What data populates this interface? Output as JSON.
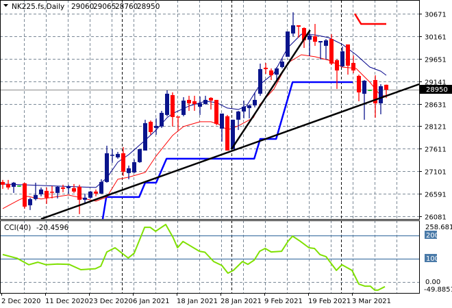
{
  "header": {
    "symbol": "NK225.fs,Daily",
    "open": "29060",
    "high": "29065",
    "low": "28760",
    "close": "28950"
  },
  "colors": {
    "bull": "#0a148c",
    "bear": "#ff0000",
    "ma_fast": "#00008b",
    "ma_slow": "#ff0000",
    "step_blue": "#0000ff",
    "step_red": "#ff0000",
    "trend": "#000000",
    "cci": "#7fe000",
    "grid": "#7a8896",
    "level": "#4a7aa8"
  },
  "chart_data": [
    {
      "type": "candlestick",
      "title": "NK225.fs,Daily",
      "ylim": [
        26081,
        30671
      ],
      "y_ticks": [
        "30671",
        "30161",
        "29651",
        "29141",
        "28631",
        "28121",
        "27611",
        "27101",
        "26591",
        "26081"
      ],
      "y_tick_values": [
        30671,
        30161,
        29651,
        29141,
        28631,
        28121,
        27611,
        27101,
        26591,
        26081
      ],
      "current_price": "28950",
      "x_labels": [
        {
          "bar": 0,
          "label": "2 Dec 2020"
        },
        {
          "bar": 8,
          "label": "11 Dec 2020"
        },
        {
          "bar": 16,
          "label": "23 Dec 2020"
        },
        {
          "bar": 24,
          "label": "6 Jan 2021"
        },
        {
          "bar": 32,
          "label": "18 Jan 2021"
        },
        {
          "bar": 40,
          "label": "28 Jan 2021"
        },
        {
          "bar": 48,
          "label": "9 Feb 2021"
        },
        {
          "bar": 56,
          "label": "19 Feb 2021"
        },
        {
          "bar": 64,
          "label": "3 Mar 2021"
        }
      ],
      "month_separators": [
        22,
        42,
        62
      ],
      "ohlc": [
        [
          26858,
          26905,
          26703,
          26796
        ],
        [
          26812,
          26905,
          26687,
          26734
        ],
        [
          26749,
          26858,
          26610,
          26842
        ],
        [
          26765,
          26780,
          26750,
          26765
        ],
        [
          26827,
          26842,
          26254,
          26300
        ],
        [
          26331,
          26502,
          26223,
          26471
        ],
        [
          26471,
          26842,
          26440,
          26564
        ],
        [
          26579,
          26734,
          26533,
          26688
        ],
        [
          26657,
          26734,
          26362,
          26502
        ],
        [
          26626,
          26765,
          26486,
          26610
        ],
        [
          26610,
          26765,
          26486,
          26749
        ],
        [
          26734,
          26796,
          26626,
          26703
        ],
        [
          26718,
          26796,
          26595,
          26749
        ],
        [
          26718,
          26812,
          26610,
          26641
        ],
        [
          26749,
          26796,
          26130,
          26455
        ],
        [
          26455,
          26595,
          26362,
          26502
        ],
        [
          26502,
          26657,
          26486,
          26641
        ],
        [
          26641,
          26688,
          26533,
          26595
        ],
        [
          26595,
          26920,
          26595,
          26858
        ],
        [
          26858,
          27680,
          26842,
          27509
        ],
        [
          27447,
          27602,
          27292,
          27463
        ],
        [
          27416,
          27540,
          27385,
          27494
        ],
        [
          27509,
          27648,
          26997,
          27090
        ],
        [
          27060,
          27230,
          26920,
          27168
        ],
        [
          27075,
          27370,
          27060,
          27308
        ],
        [
          27308,
          27602,
          27292,
          27602
        ],
        [
          27571,
          28268,
          27571,
          28191
        ],
        [
          28222,
          28253,
          27928,
          27990
        ],
        [
          28083,
          28300,
          27928,
          28129
        ],
        [
          28114,
          28470,
          28083,
          28424
        ],
        [
          28377,
          28935,
          28346,
          28858
        ],
        [
          28826,
          28888,
          28114,
          28330
        ],
        [
          28330,
          28330,
          28036,
          28315
        ],
        [
          28377,
          28780,
          28346,
          28702
        ],
        [
          28718,
          28811,
          28470,
          28640
        ],
        [
          28687,
          28811,
          28470,
          28625
        ],
        [
          28563,
          28795,
          28377,
          28640
        ],
        [
          28625,
          28811,
          28610,
          28718
        ],
        [
          28764,
          28780,
          28501,
          28702
        ],
        [
          28718,
          28718,
          28145,
          28176
        ],
        [
          28067,
          28408,
          27772,
          28408
        ],
        [
          28346,
          28377,
          27571,
          27571
        ],
        [
          27602,
          28269,
          27602,
          28269
        ],
        [
          28269,
          28470,
          28036,
          28455
        ],
        [
          28455,
          28703,
          28300,
          28563
        ],
        [
          28532,
          28610,
          28300,
          28594
        ],
        [
          28594,
          28888,
          28548,
          28718
        ],
        [
          28858,
          29540,
          28811,
          29416
        ],
        [
          29446,
          29555,
          29307,
          29416
        ],
        [
          29385,
          29431,
          29168,
          29276
        ],
        [
          29291,
          29462,
          29121,
          29431
        ],
        [
          29462,
          29664,
          29431,
          29586
        ],
        [
          29695,
          30268,
          29695,
          30268
        ],
        [
          30222,
          30702,
          30160,
          30408
        ],
        [
          30408,
          30408,
          30129,
          30377
        ],
        [
          30346,
          30361,
          29896,
          30067
        ],
        [
          30082,
          30253,
          29710,
          30175
        ],
        [
          30160,
          30439,
          29943,
          30036
        ],
        [
          30020,
          30051,
          29633,
          30051
        ],
        [
          29943,
          30098,
          29633,
          30067
        ],
        [
          30098,
          30206,
          29509,
          29540
        ],
        [
          29617,
          29633,
          28966,
          29385
        ],
        [
          29478,
          29927,
          29462,
          29819
        ],
        [
          29974,
          29974,
          29291,
          29493
        ],
        [
          29555,
          29726,
          29323,
          29385
        ],
        [
          29261,
          29291,
          28687,
          28888
        ],
        [
          28857,
          29168,
          28268,
          29152
        ],
        [
          28935,
          28950,
          28920,
          28935
        ],
        [
          29168,
          29276,
          28315,
          28640
        ],
        [
          28640,
          29075,
          28392,
          29028
        ],
        [
          29060,
          29065,
          28760,
          28950
        ]
      ],
      "ma_fast": [
        [
          0,
          26812
        ],
        [
          17,
          26734
        ],
        [
          19,
          26951
        ],
        [
          21,
          27308
        ],
        [
          23,
          27478
        ],
        [
          26,
          27804
        ],
        [
          28,
          28036
        ],
        [
          30,
          28315
        ],
        [
          31,
          28408
        ],
        [
          34,
          28579
        ],
        [
          37,
          28687
        ],
        [
          39,
          28656
        ],
        [
          41,
          28532
        ],
        [
          43,
          28501
        ],
        [
          44.5,
          28579
        ],
        [
          47,
          29074
        ],
        [
          49.5,
          29323
        ],
        [
          52,
          29896
        ],
        [
          54.5,
          30206
        ],
        [
          57,
          30191
        ],
        [
          59.5,
          30129
        ],
        [
          62,
          29974
        ],
        [
          64.5,
          29741
        ],
        [
          67,
          29462
        ],
        [
          69,
          29369
        ],
        [
          70,
          29276
        ]
      ],
      "ma_slow": [
        [
          0,
          26254
        ],
        [
          3,
          26455
        ],
        [
          4.5,
          26533
        ],
        [
          7,
          26471
        ],
        [
          12,
          26564
        ],
        [
          17,
          26424
        ],
        [
          19,
          26517
        ],
        [
          21,
          26920
        ],
        [
          23,
          26966
        ],
        [
          26,
          27075
        ],
        [
          28,
          27447
        ],
        [
          31,
          27912
        ],
        [
          33,
          28114
        ],
        [
          36,
          28222
        ],
        [
          38,
          28222
        ],
        [
          39.5,
          28160
        ],
        [
          41,
          28036
        ],
        [
          43,
          28129
        ],
        [
          45.75,
          28315
        ],
        [
          47,
          28625
        ],
        [
          49.5,
          28966
        ],
        [
          52,
          29555
        ],
        [
          54.5,
          29741
        ],
        [
          57,
          29695
        ],
        [
          59.5,
          29617
        ],
        [
          62,
          29462
        ],
        [
          64.5,
          29431
        ],
        [
          67,
          29121
        ],
        [
          69,
          28811
        ],
        [
          70,
          28811
        ]
      ],
      "step_blue": [
        [
          18.25,
          26021
        ],
        [
          18.9,
          26517
        ],
        [
          24.9,
          26517
        ],
        [
          26,
          26842
        ],
        [
          28,
          26842
        ],
        [
          29.9,
          27385
        ],
        [
          45.9,
          27385
        ],
        [
          47,
          27834
        ],
        [
          49.9,
          27834
        ],
        [
          52.9,
          29121
        ],
        [
          63.9,
          29121
        ]
      ],
      "step_red": [
        [
          64.25,
          30671
        ],
        [
          65.4,
          30439
        ],
        [
          70,
          30439
        ]
      ],
      "trendlines": [
        [
          [
            7,
            26021
          ],
          [
            76,
            29074
          ]
        ],
        [
          [
            41.75,
            27602
          ],
          [
            56.1,
            30299
          ]
        ]
      ]
    },
    {
      "type": "line",
      "title": "CCI(40)",
      "value_label": "-20.4596",
      "ylim": [
        -49.8851,
        258.6815
      ],
      "y_labels": {
        "max": "258.6815",
        "l200": "200",
        "l100": "100",
        "zero": "0.00",
        "min": "-49.8851"
      },
      "levels": [
        200,
        100,
        0
      ],
      "points": [
        [
          0,
          118
        ],
        [
          2.6,
          102
        ],
        [
          4.75,
          74
        ],
        [
          6.4,
          85
        ],
        [
          7.9,
          74
        ],
        [
          10,
          77
        ],
        [
          12.1,
          76
        ],
        [
          14.25,
          53
        ],
        [
          16.9,
          57
        ],
        [
          17.9,
          68
        ],
        [
          19,
          129
        ],
        [
          20.5,
          147
        ],
        [
          22.9,
          103
        ],
        [
          24,
          124
        ],
        [
          25.9,
          235
        ],
        [
          26.9,
          235
        ],
        [
          27.9,
          218
        ],
        [
          29.75,
          247
        ],
        [
          31.1,
          191
        ],
        [
          31.9,
          147
        ],
        [
          32.9,
          174
        ],
        [
          35.9,
          132
        ],
        [
          36.9,
          128
        ],
        [
          38.5,
          88
        ],
        [
          40,
          71
        ],
        [
          41.1,
          38
        ],
        [
          42.1,
          50
        ],
        [
          43.75,
          88
        ],
        [
          44.75,
          76
        ],
        [
          45.9,
          94
        ],
        [
          46.9,
          132
        ],
        [
          47.9,
          144
        ],
        [
          49,
          129
        ],
        [
          50.9,
          132
        ],
        [
          52.1,
          176
        ],
        [
          52.9,
          197
        ],
        [
          54.25,
          176
        ],
        [
          55.9,
          147
        ],
        [
          56.9,
          144
        ],
        [
          57.9,
          118
        ],
        [
          59,
          109
        ],
        [
          60.9,
          50
        ],
        [
          61.9,
          74
        ],
        [
          63.75,
          50
        ],
        [
          65,
          -9
        ],
        [
          66.1,
          -18
        ],
        [
          67.1,
          -18
        ],
        [
          67.9,
          -35
        ],
        [
          68.5,
          -35
        ],
        [
          69.75,
          -20
        ]
      ]
    }
  ]
}
